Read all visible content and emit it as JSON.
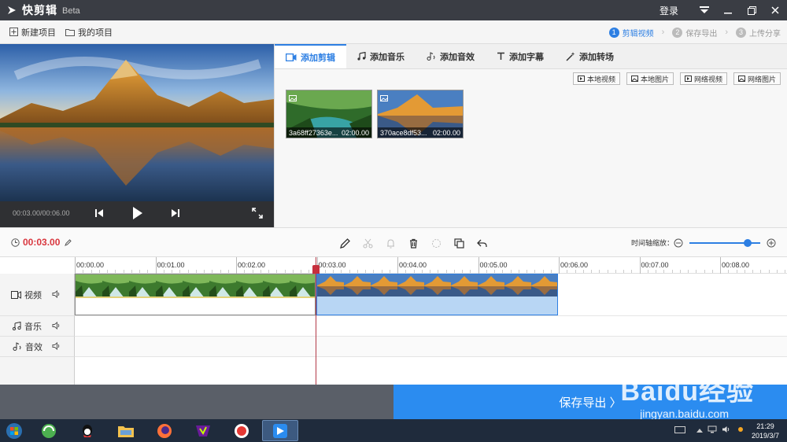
{
  "app": {
    "name": "快剪辑",
    "badge": "Beta",
    "login": "登录"
  },
  "toolbar": {
    "new_project": "新建项目",
    "my_projects": "我的项目"
  },
  "steps": [
    {
      "num": "1",
      "label": "剪辑视频"
    },
    {
      "num": "2",
      "label": "保存导出"
    },
    {
      "num": "3",
      "label": "上传分享"
    }
  ],
  "preview": {
    "time": "00:03.00/00:06.00"
  },
  "tabs": [
    "添加剪辑",
    "添加音乐",
    "添加音效",
    "添加字幕",
    "添加转场"
  ],
  "sources": [
    "本地视频",
    "本地图片",
    "网络视频",
    "网络图片"
  ],
  "media_items": [
    {
      "name": "3a68ff27363e...",
      "duration": "02:00.00"
    },
    {
      "name": "370ace8df53...",
      "duration": "02:00.00"
    }
  ],
  "edit": {
    "current_time": "00:03.00",
    "zoom_label": "时间轴缩放：",
    "zoom_level": 0.82
  },
  "ruler": [
    "00:00.00",
    "00:01.00",
    "00:02.00",
    "00:03.00",
    "00:04.00",
    "00:05.00",
    "00:06.00",
    "00:07.00",
    "00:08.00"
  ],
  "tracks": {
    "video": "视频",
    "music": "音乐",
    "sfx": "音效"
  },
  "export": {
    "label": "保存导出 〉"
  },
  "taskbar": {
    "time": "21:29",
    "date": "2019/3/7"
  },
  "watermark": {
    "logo": "Baidu经验",
    "url": "jingyan.baidu.com"
  },
  "colors": {
    "accent": "#2b8cf0",
    "playhead": "#c62f3d",
    "titlebar": "#3a3d44"
  }
}
